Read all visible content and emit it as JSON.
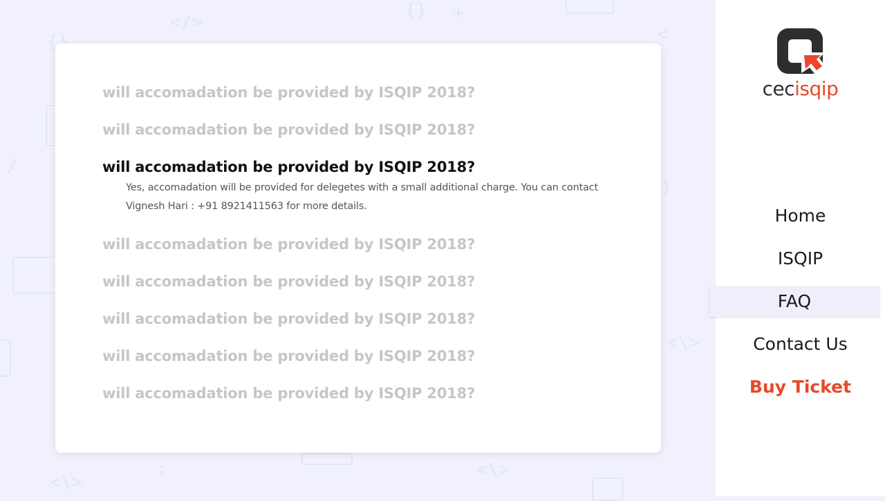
{
  "brand": {
    "name_prefix": "cec",
    "name_accent": "isqip",
    "accent_color": "#e8492a",
    "logo_icon": "logo-icon"
  },
  "faq": {
    "items": [
      {
        "question": "will accomadation be provided by ISQIP 2018?",
        "expanded": false
      },
      {
        "question": "will accomadation be provided by ISQIP 2018?",
        "expanded": false
      },
      {
        "question": "will accomadation be provided by ISQIP 2018?",
        "expanded": true,
        "answer": "Yes, accomadation will be provided for delegetes with a small additional charge. You can contact Vignesh Hari : +91 8921411563 for more details."
      },
      {
        "question": "will accomadation be provided by ISQIP 2018?",
        "expanded": false
      },
      {
        "question": "will accomadation be provided by ISQIP 2018?",
        "expanded": false
      },
      {
        "question": "will accomadation be provided by ISQIP 2018?",
        "expanded": false
      },
      {
        "question": "will accomadation be provided by ISQIP 2018?",
        "expanded": false
      },
      {
        "question": "will accomadation be provided by ISQIP 2018?",
        "expanded": false
      }
    ]
  },
  "nav": {
    "items": [
      {
        "label": "Home",
        "active": false
      },
      {
        "label": "ISQIP",
        "active": false
      },
      {
        "label": "FAQ",
        "active": true
      },
      {
        "label": "Contact Us",
        "active": false
      },
      {
        "label": "Buy Ticket",
        "active": false,
        "highlight": true
      }
    ]
  }
}
